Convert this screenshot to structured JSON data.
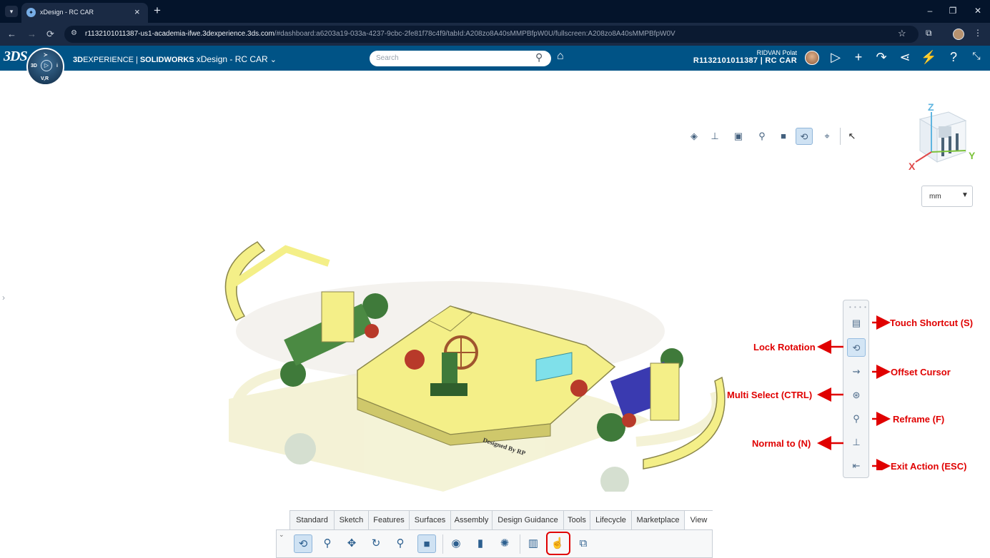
{
  "browser": {
    "tab_title": "xDesign - RC CAR",
    "url_host": "r1132101011387-us1-academia-ifwe.3dexperience.3ds.com",
    "url_rest": "/#dashboard:a6203a19-033a-4237-9cbc-2fe81f78c4f9/tabId:A208zo8A40sMMPBfpW0U/fullscreen:A208zo8A40sMMPBfpW0V"
  },
  "header": {
    "brand_prefix": "3D",
    "brand_experience": "EXPERIENCE",
    "brand_separator": "|",
    "brand_solidworks": "SOLIDWORKS",
    "app_name": "xDesign - RC CAR",
    "search_placeholder": "Search",
    "user_name": "RIDVAN Polat",
    "context": "R1132101011387 | RC CAR",
    "compass_label": "V,R"
  },
  "viewcube": {
    "x": "X",
    "y": "Y",
    "z": "Z"
  },
  "units": {
    "selected": "mm"
  },
  "ribbon": {
    "tabs": [
      "Standard",
      "Sketch",
      "Features",
      "Surfaces",
      "Assembly",
      "Design Guidance",
      "Tools",
      "Lifecycle",
      "Marketplace",
      "View"
    ],
    "active_tab": "View"
  },
  "annotations": {
    "touch_shortcut": "Touch Shortcut (S)",
    "lock_rotation": "Lock Rotation",
    "offset_cursor": "Offset Cursor",
    "multi_select": "Multi Select (CTRL)",
    "reframe": "Reframe (F)",
    "normal_to": "Normal to (N)",
    "exit_action": "Exit Action (ESC)"
  },
  "model": {
    "engraving": "Designed By RP"
  },
  "colors": {
    "accent": "#005386",
    "annotation": "#e00000",
    "model_body": "#f4ef88",
    "model_parts": "#3f7a3a"
  }
}
